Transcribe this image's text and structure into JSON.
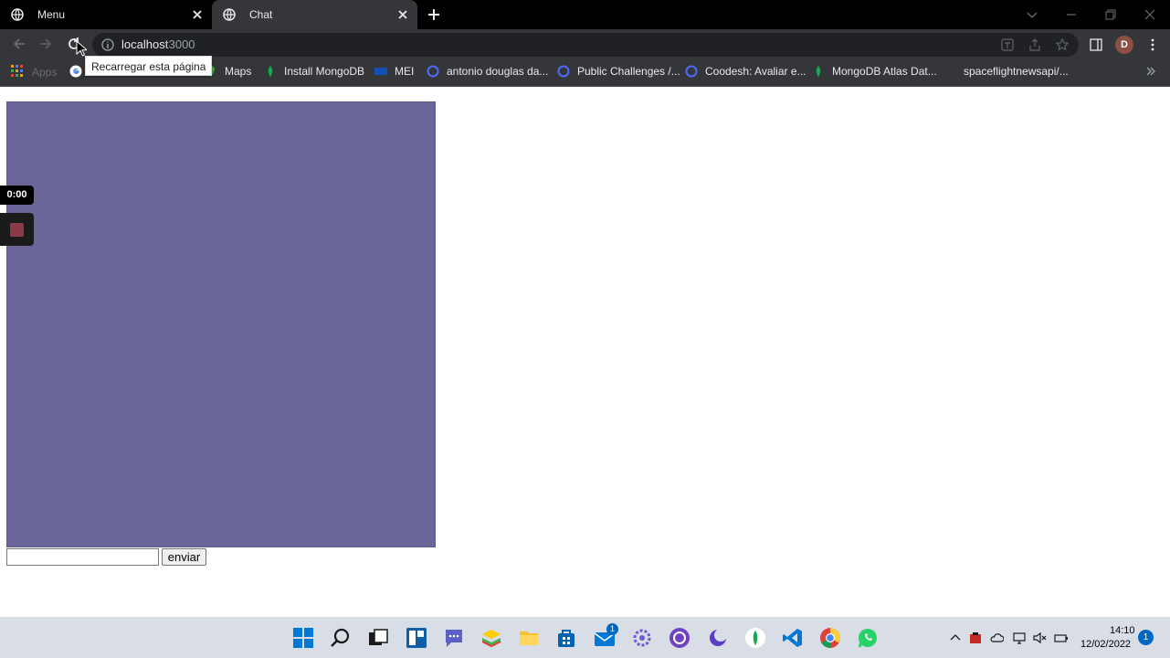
{
  "browser": {
    "tabs": [
      {
        "title": "Menu"
      },
      {
        "title": "Chat"
      }
    ],
    "address": {
      "host": "localhost",
      "port": ":3000"
    },
    "tooltip": "Recarregar esta página",
    "profile_initial": "D",
    "bookmarks": {
      "apps": "Apps",
      "items": [
        {
          "label": "Maps"
        },
        {
          "label": "Install MongoDB"
        },
        {
          "label": "MEI"
        },
        {
          "label": "antonio douglas da..."
        },
        {
          "label": "Public Challenges /..."
        },
        {
          "label": "Coodesh: Avaliar e..."
        },
        {
          "label": "MongoDB Atlas Dat..."
        },
        {
          "label": "spaceflightnewsapi/..."
        }
      ]
    }
  },
  "page": {
    "recorder": {
      "timer": "0:00"
    },
    "send_button": "enviar",
    "message_value": "",
    "colors": {
      "chat_background": "#6a6699",
      "stop_button": "#8b3a48"
    }
  },
  "taskbar": {
    "time": "14:10",
    "date": "12/02/2022",
    "notification_count": "1",
    "mail_badge": "1"
  }
}
